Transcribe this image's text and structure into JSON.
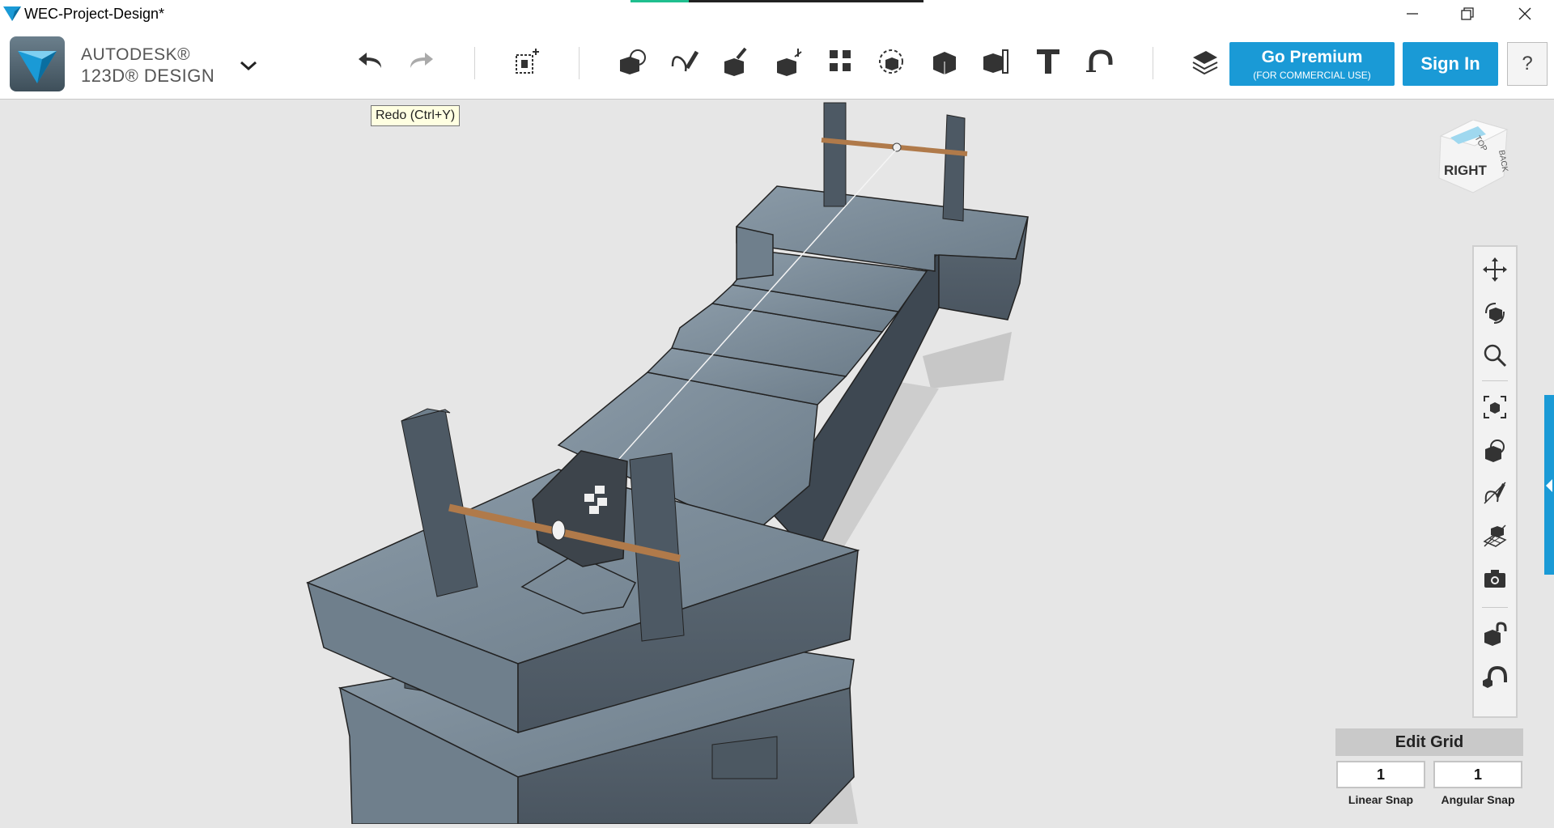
{
  "window": {
    "title": "WEC-Project-Design*",
    "controls": {
      "minimize_icon": "minimize-icon",
      "restore_icon": "restore-icon",
      "close_icon": "close-icon"
    }
  },
  "toolbar": {
    "brand_line1": "AUTODESK®",
    "brand_line2": "123D® DESIGN",
    "tools": [
      "undo-icon",
      "redo-icon",
      "transform-icon",
      "primitives-icon",
      "sketch-icon",
      "construct-icon",
      "modify-icon",
      "pattern-icon",
      "grouping-icon",
      "combine-icon",
      "measure-icon",
      "text-icon",
      "snap-icon",
      "materials-icon"
    ],
    "premium_label": "Go Premium",
    "premium_sub": "(FOR COMMERCIAL USE)",
    "signin_label": "Sign In",
    "help_label": "?"
  },
  "tooltip": {
    "text": "Redo (Ctrl+Y)"
  },
  "viewcube": {
    "face_front": "RIGHT",
    "face_top": "TOP",
    "face_side": "BACK"
  },
  "navigation": {
    "tools": [
      "pan-icon",
      "orbit-icon",
      "zoom-icon",
      "fit-icon",
      "view-mode-icon",
      "hide-sketch-icon",
      "hide-grid-icon",
      "screenshot-icon",
      "snap-to-icon",
      "magnet-icon"
    ]
  },
  "grid": {
    "edit_label": "Edit Grid",
    "linear_snap_value": "1",
    "angular_snap_value": "1",
    "linear_snap_label": "Linear Snap",
    "angular_snap_label": "Angular Snap"
  },
  "colors": {
    "accent": "#1a9ad6",
    "wood": "#7c8c99",
    "rod": "#b07a4a"
  }
}
